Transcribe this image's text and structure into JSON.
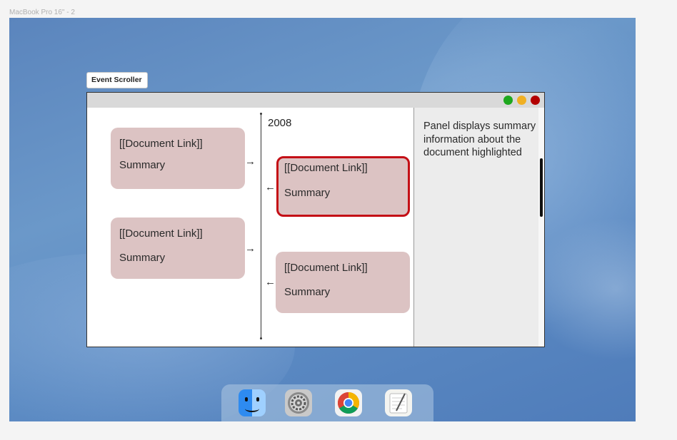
{
  "frame": {
    "label": "MacBook Pro 16\" - 2"
  },
  "app": {
    "tag_label": "Event Scroller"
  },
  "window": {
    "controls": {
      "green": "#1ea81e",
      "yellow": "#f0b023",
      "red": "#b30000"
    }
  },
  "timeline": {
    "year": "2008",
    "cards": [
      {
        "link": "[[Document Link]]",
        "summary": "Summary",
        "side": "left",
        "arrow": "→",
        "selected": false
      },
      {
        "link": "[[Document Link]]",
        "summary": "Summary",
        "side": "right",
        "arrow": "←",
        "selected": true
      },
      {
        "link": "[[Document Link]]",
        "summary": "Summary",
        "side": "left",
        "arrow": "→",
        "selected": false
      },
      {
        "link": "[[Document Link]]",
        "summary": "Summary",
        "side": "right",
        "arrow": "←",
        "selected": false
      }
    ],
    "selected_border_color": "#c40f16",
    "card_color": "#dcc3c3"
  },
  "side_panel": {
    "text": "Panel displays summary information about the document highlighted"
  },
  "dock": {
    "apps": [
      {
        "icon": "finder-icon"
      },
      {
        "icon": "system-settings-icon"
      },
      {
        "icon": "chrome-icon"
      },
      {
        "icon": "notes-icon"
      }
    ]
  }
}
